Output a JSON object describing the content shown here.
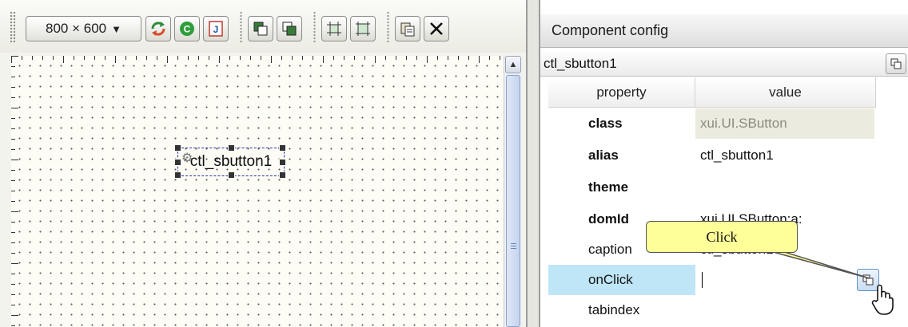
{
  "toolbar": {
    "canvas_size": "800 × 600",
    "buttons": [
      {
        "name": "refresh-icon",
        "color": "#d84a2a"
      },
      {
        "name": "c-icon",
        "label": "C",
        "color": "#2e9d3a"
      },
      {
        "name": "j-icon",
        "label": "J",
        "color": "#c0392b"
      },
      {
        "name": "bring-front-icon"
      },
      {
        "name": "send-back-icon"
      },
      {
        "name": "align-grid-icon"
      },
      {
        "name": "fit-grid-icon"
      },
      {
        "name": "copy-icon"
      },
      {
        "name": "delete-icon"
      }
    ]
  },
  "canvas": {
    "widget_caption": "ctl_sbutton1",
    "grid_dot_color": "#5a5a5a",
    "selection_color": "#2233aa"
  },
  "config_panel": {
    "title": "Component config",
    "path": "ctl_sbutton1",
    "columns": [
      "property",
      "value"
    ],
    "rows": [
      {
        "name": "class",
        "value": "xui.UI.SButton",
        "bold": true,
        "readonly": true
      },
      {
        "name": "alias",
        "value": "ctl_sbutton1",
        "bold": true
      },
      {
        "name": "theme",
        "value": "",
        "bold": true
      },
      {
        "name": "domId",
        "value": "xui.UI.SButton:a:",
        "bold": true
      },
      {
        "name": "caption",
        "value": "ctl_sbutton1",
        "bold": false
      },
      {
        "name": "onClick",
        "value": "",
        "bold": false,
        "selected": true
      },
      {
        "name": "tabindex",
        "value": "",
        "bold": false
      }
    ],
    "selected_row_color": "#bfe6f7"
  },
  "callout": {
    "text": "Click",
    "background": "#ffff99"
  }
}
